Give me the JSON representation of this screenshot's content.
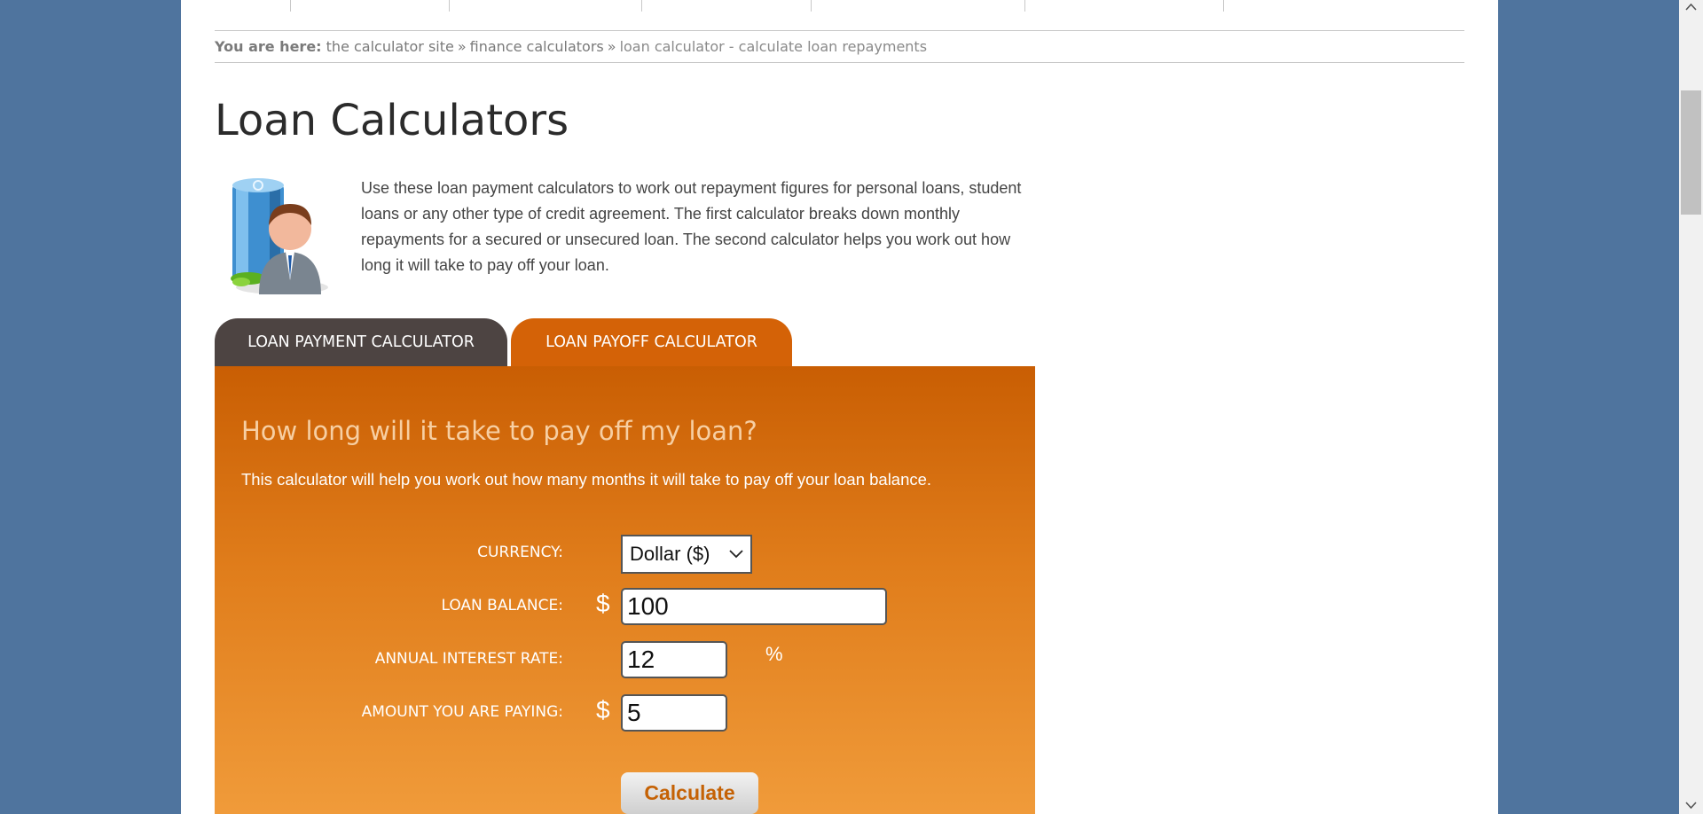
{
  "breadcrumb": {
    "prefix": "You are here:",
    "items": [
      "the calculator site",
      "finance calculators",
      "loan calculator - calculate loan repayments"
    ],
    "separator": "»"
  },
  "page_title": "Loan Calculators",
  "intro": "Use these loan payment calculators to work out repayment figures for personal loans, student loans or any other type of credit agreement. The first calculator breaks down monthly repayments for a secured or unsecured loan. The second calculator helps you work out how long it will take to pay off your loan.",
  "tabs": [
    {
      "label": "LOAN PAYMENT CALCULATOR",
      "active": false
    },
    {
      "label": "LOAN PAYOFF CALCULATOR",
      "active": true
    }
  ],
  "calculator": {
    "heading": "How long will it take to pay off my loan?",
    "description": "This calculator will help you work out how many months it will take to pay off your loan balance.",
    "currency": {
      "label": "CURRENCY:",
      "value": "Dollar ($)"
    },
    "loan_balance": {
      "label": "LOAN BALANCE:",
      "symbol": "$",
      "value": "100"
    },
    "interest_rate": {
      "label": "ANNUAL INTEREST RATE:",
      "value": "12",
      "suffix": "%"
    },
    "payment": {
      "label": "AMOUNT YOU ARE PAYING:",
      "symbol": "$",
      "value": "5"
    },
    "button_label": "Calculate"
  },
  "colors": {
    "background": "#4f749e",
    "tab_inactive": "#4d4442",
    "tab_active": "#d46207",
    "panel_top": "#c95e03",
    "panel_bottom": "#f09b3a"
  }
}
